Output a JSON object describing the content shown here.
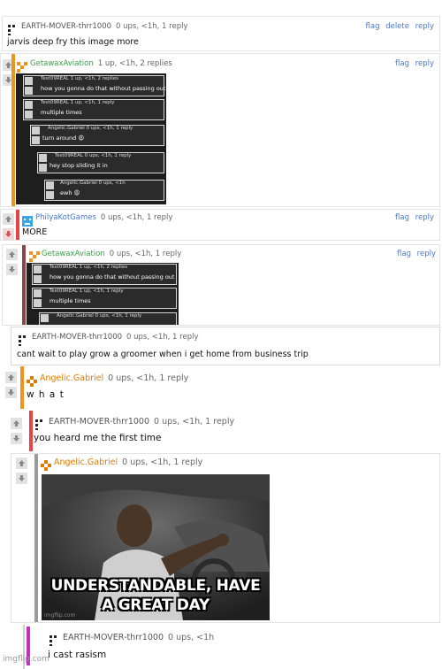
{
  "comments": [
    {
      "user": "EARTH-MOVER-thrr1000",
      "meta": "0 ups, <1h, 1 reply",
      "actions": [
        "flag",
        "delete",
        "reply"
      ],
      "text": "jarvis deep fry this image more"
    },
    {
      "user": "GetawaxAviation",
      "meta": "1 up, <1h, 2 replies",
      "actions": [
        "flag",
        "reply"
      ]
    },
    {
      "user": "PhilyaKotGames",
      "meta": "0 ups, <1h, 1 reply",
      "actions": [
        "flag",
        "reply"
      ],
      "text": "MORE"
    },
    {
      "user": "GetawaxAviation",
      "meta": "0 ups, <1h, 1 reply",
      "actions": [
        "flag",
        "reply"
      ]
    },
    {
      "user": "EARTH-MOVER-thrr1000",
      "meta": "0 ups, <1h, 1 reply",
      "text": "cant wait to play grow a groomer when i get home from business trip"
    },
    {
      "user": "Angelic.Gabriel",
      "meta": "0 ups, <1h, 1 reply",
      "text": "w h a t"
    },
    {
      "user": "EARTH-MOVER-thrr1000",
      "meta": "0 ups, <1h, 1 reply",
      "text": "you heard me the first time"
    },
    {
      "user": "Angelic.Gabriel",
      "meta": "0 ups, <1h, 1 reply"
    },
    {
      "user": "EARTH-MOVER-thrr1000",
      "meta": "0 ups, <1h",
      "text": "i cast rasism"
    }
  ],
  "embedded_first": [
    {
      "meta": "Test09REAL 1 up, <1h, 2 replies",
      "text": "how you gonna do that without passing out"
    },
    {
      "meta": "Test09REAL 1 up, <1h, 1 reply",
      "text": "multiple times"
    },
    {
      "meta": "Angelic.Gabriel 0 ups, <1h, 1 reply",
      "text": "turn around 😩"
    },
    {
      "meta": "Test09REAL 0 ups, <1h, 1 reply",
      "text": "hey stop sliding it in"
    },
    {
      "meta": "Angelic.Gabriel 0 ups, <1h",
      "text": "ewh 😩"
    }
  ],
  "embedded_second": [
    {
      "meta": "Test09REAL 1 up, <1h, 2 replies",
      "text": "how you gonna do that without passing out"
    },
    {
      "meta": "Test09REAL 1 up, <1h, 1 reply",
      "text": "multiple times"
    },
    {
      "meta": "Angelic.Gabriel 0 ups, <1h, 1 reply",
      "text": ""
    }
  ],
  "meme_caption": [
    "UNDERSTANDABLE, HAVE",
    "A GREAT DAY"
  ],
  "meme_watermark": "imgflip.com",
  "page_watermark": "imgflip.com",
  "colors": {
    "link": "#4a78c8",
    "username_green": "#3aa14a",
    "username_orange": "#e07a00",
    "bar_orange": "#f0931e",
    "bar_red": "#e64545",
    "bar_gray": "#9a9a9a",
    "bar_blue": "#5b82c7",
    "bar_magenta": "#c42fc7"
  }
}
